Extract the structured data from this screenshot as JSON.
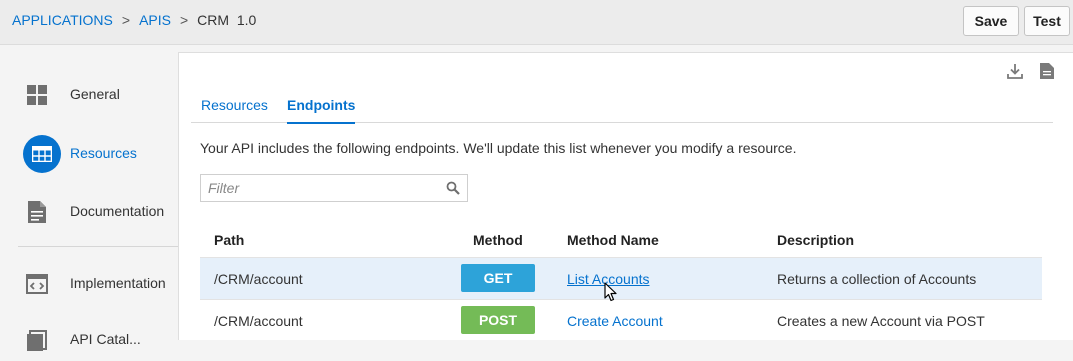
{
  "breadcrumb": {
    "applications": "APPLICATIONS",
    "sep1": ">",
    "apis": "APIS",
    "sep2": ">",
    "current": "CRM  1.0"
  },
  "toolbar": {
    "save_label": "Save",
    "test_label": "Test"
  },
  "sidebar": {
    "items": [
      {
        "label": "General",
        "icon": "grid-icon"
      },
      {
        "label": "Resources",
        "icon": "table-icon",
        "active": true
      },
      {
        "label": "Documentation",
        "icon": "document-icon"
      },
      {
        "label": "Implementation",
        "icon": "code-icon"
      },
      {
        "label": "API Catal...",
        "icon": "catalog-icon"
      }
    ]
  },
  "panel": {
    "icons": [
      "download-icon",
      "page-icon"
    ],
    "tabs": [
      {
        "label": "Resources",
        "active": false
      },
      {
        "label": "Endpoints",
        "active": true
      }
    ],
    "intro": "Your API includes the following endpoints. We'll update this list whenever you modify a resource.",
    "filter": {
      "placeholder": "Filter",
      "value": ""
    }
  },
  "table": {
    "headers": {
      "path": "Path",
      "method": "Method",
      "method_name": "Method Name",
      "description": "Description"
    },
    "rows": [
      {
        "path": "/CRM/account",
        "method": "GET",
        "method_name": "List Accounts",
        "description": "Returns a collection of Accounts"
      },
      {
        "path": "/CRM/account",
        "method": "POST",
        "method_name": "Create Account",
        "description": "Creates a new Account via POST"
      }
    ]
  },
  "colors": {
    "accent": "#0572ce",
    "get_badge": "#2da3d9",
    "post_badge": "#74bb57",
    "selected_row": "#e6f0fa"
  }
}
